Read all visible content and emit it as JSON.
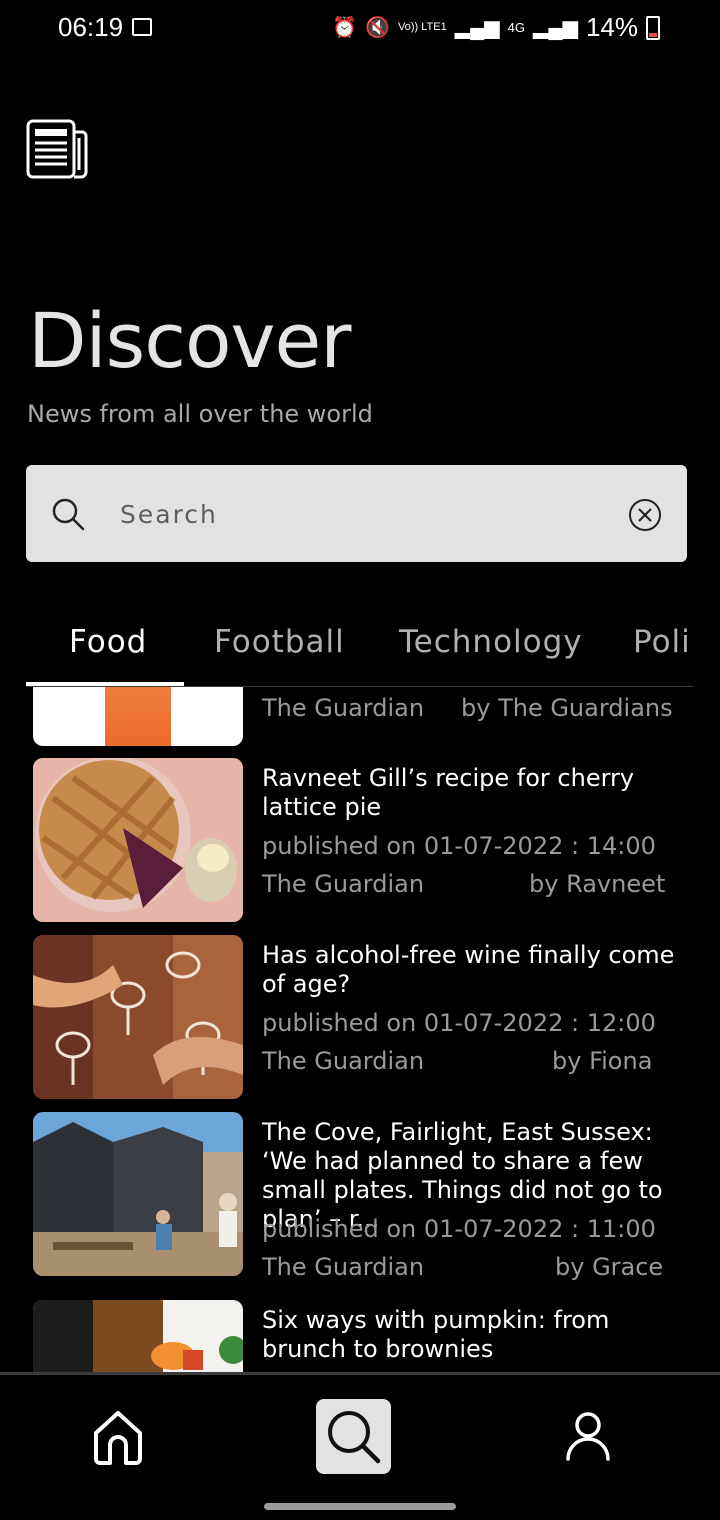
{
  "status_bar": {
    "time": "06:19",
    "network_label": "Vo)) LTE1",
    "network2_label": "4G",
    "battery": "14%"
  },
  "header": {
    "logo_icon": "newspaper-icon",
    "title": "Discover",
    "subtitle": "News from all over the world"
  },
  "search": {
    "placeholder": "Search",
    "value": ""
  },
  "tabs": [
    {
      "label": "Food",
      "active": true
    },
    {
      "label": "Football",
      "active": false
    },
    {
      "label": "Technology",
      "active": false
    },
    {
      "label": "Poli",
      "active": false
    }
  ],
  "articles": [
    {
      "title": "",
      "date": "",
      "source": "The Guardian",
      "author": "by The Guardians"
    },
    {
      "title": "Ravneet Gill’s recipe for cherry lattice pie",
      "date": "published on 01-07-2022 : 14:00",
      "source": "The Guardian",
      "author": "by Ravneet"
    },
    {
      "title": "Has alcohol-free wine finally come of age?",
      "date": "published on 01-07-2022 : 12:00",
      "source": "The Guardian",
      "author": "by Fiona"
    },
    {
      "title": "The Cove, Fairlight, East Sussex: ‘We had planned to share a few small plates. Things did not go to plan’ – r...",
      "date": "published on 01-07-2022 : 11:00",
      "source": "The Guardian",
      "author": "by Grace"
    },
    {
      "title": "Six ways with pumpkin: from brunch to brownies",
      "date": "",
      "source": "",
      "author": ""
    }
  ],
  "bottom_nav": [
    {
      "icon": "home-icon",
      "active": false
    },
    {
      "icon": "search-icon",
      "active": true
    },
    {
      "icon": "person-icon",
      "active": false
    }
  ]
}
